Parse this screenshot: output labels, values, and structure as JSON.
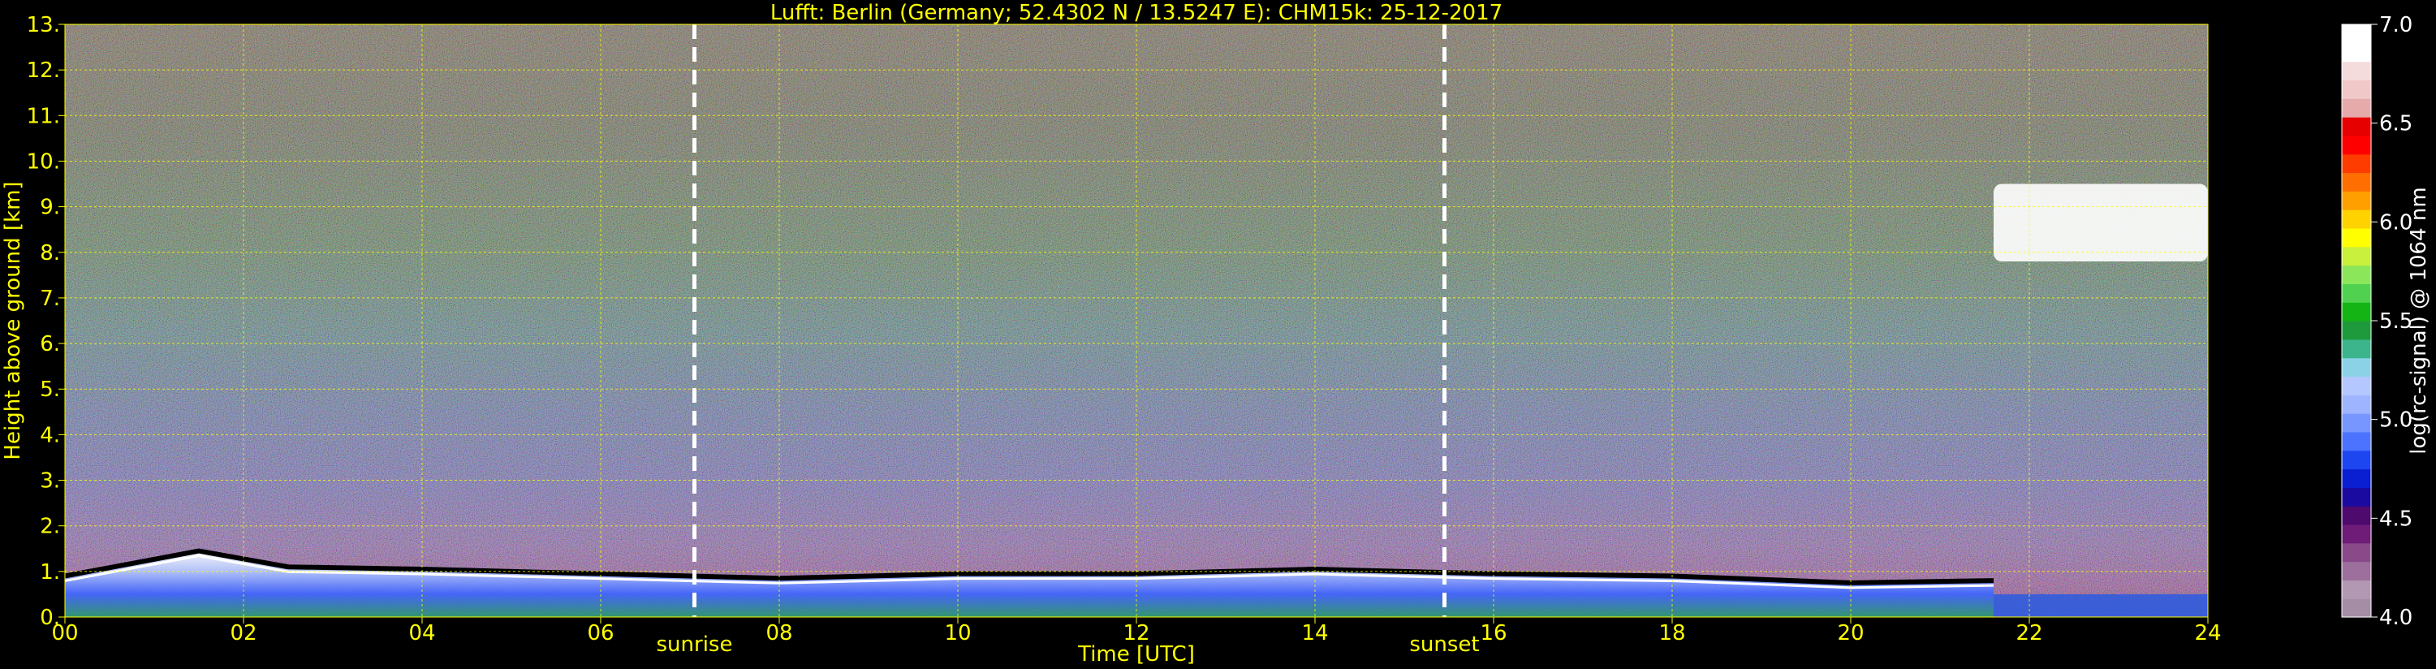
{
  "chart_data": {
    "type": "heatmap",
    "title": "Lufft: Berlin (Germany; 52.4302 N / 13.5247 E):    CHM15k: 25-12-2017",
    "xlabel": "Time [UTC]",
    "ylabel": "Height above ground [km]",
    "xlim": [
      0,
      24
    ],
    "ylim": [
      0,
      13
    ],
    "x_ticks": [
      0,
      2,
      4,
      6,
      8,
      10,
      12,
      14,
      16,
      18,
      20,
      22,
      24
    ],
    "x_tick_labels": [
      "00",
      "02",
      "04",
      "06",
      "08",
      "10",
      "12",
      "14",
      "16",
      "18",
      "20",
      "22",
      "24"
    ],
    "y_ticks": [
      0,
      1,
      2,
      3,
      4,
      5,
      6,
      7,
      8,
      9,
      10,
      11,
      12,
      13
    ],
    "y_tick_labels": [
      "0.",
      "1.",
      "2.",
      "3.",
      "4.",
      "5.",
      "6.",
      "7.",
      "8.",
      "9.",
      "10.",
      "11.",
      "12.",
      "13."
    ],
    "grid": true,
    "colorbar": {
      "label": "log(rc-signal) @ 1064 nm",
      "range": [
        4.0,
        7.0
      ],
      "ticks": [
        4.0,
        4.5,
        5.0,
        5.5,
        6.0,
        6.5,
        7.0
      ],
      "tick_labels": [
        "4.0",
        "4.5",
        "5.0",
        "5.5",
        "6.0",
        "6.5",
        "7.0"
      ],
      "colors": [
        "#a58da5",
        "#b398b3",
        "#9c6f9c",
        "#8a4a8a",
        "#6e1c78",
        "#4f0a6e",
        "#1a0aa0",
        "#0a1ed2",
        "#1e46f0",
        "#4c73ff",
        "#7896ff",
        "#9fb4ff",
        "#b4c8ff",
        "#8cd2e6",
        "#3cb48c",
        "#1e9a3c",
        "#14b414",
        "#50d250",
        "#8ce65a",
        "#c8f03c",
        "#ffff00",
        "#ffd200",
        "#ffa000",
        "#ff6e00",
        "#ff3c00",
        "#ff0000",
        "#e60000",
        "#e6aaaa",
        "#f0c8c8",
        "#f5dcdc",
        "#ffffff",
        "#ffffff"
      ]
    },
    "annotations": [
      {
        "x": 7.05,
        "label": "sunrise",
        "style": "dashed",
        "color": "#ffffff"
      },
      {
        "x": 15.45,
        "label": "sunset",
        "style": "dashed",
        "color": "#ffffff"
      }
    ],
    "features": {
      "boundary_layer_top_km": [
        [
          0,
          0.9
        ],
        [
          1.5,
          1.45
        ],
        [
          2.5,
          1.1
        ],
        [
          4,
          1.05
        ],
        [
          6,
          0.95
        ],
        [
          8,
          0.85
        ],
        [
          10,
          0.95
        ],
        [
          12,
          0.95
        ],
        [
          14,
          1.05
        ],
        [
          16,
          0.95
        ],
        [
          18,
          0.9
        ],
        [
          20,
          0.75
        ],
        [
          21.6,
          0.8
        ]
      ],
      "upper_cloud": {
        "x_range": [
          21.6,
          24
        ],
        "height_km": [
          7.8,
          9.5
        ]
      }
    }
  },
  "colors": {
    "axis_text": "#ffff00",
    "colorbar_text": "#ffffff",
    "grid": "#ffff00",
    "background": "#000000"
  }
}
